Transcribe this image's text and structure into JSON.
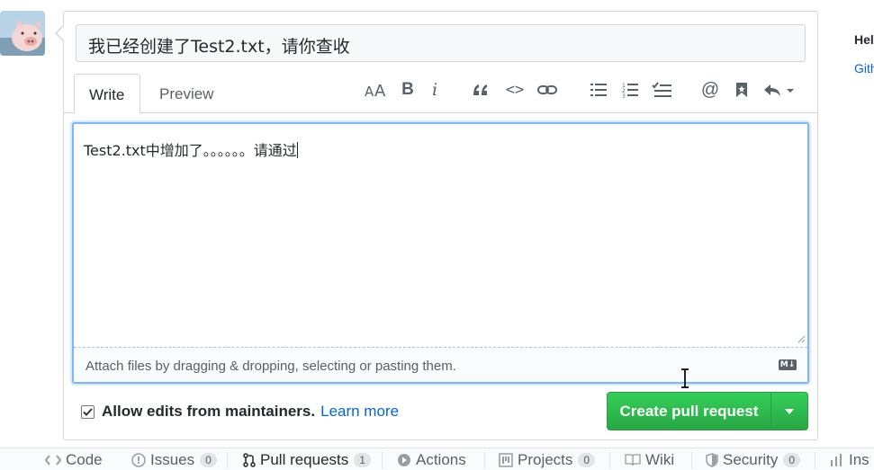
{
  "pr": {
    "title_value": "我已经创建了Test2.txt，请你查收",
    "tabs": [
      {
        "label": "Write"
      },
      {
        "label": "Preview"
      }
    ],
    "toolbar": {
      "header_icon": "text-size-icon",
      "bold_label": "B",
      "italic_label": "i",
      "quote_icon": "quote-icon",
      "code_label": "<>",
      "link_icon": "link-icon",
      "ul_icon": "unordered-list-icon",
      "ol_icon": "ordered-list-icon",
      "tasklist_icon": "task-list-icon",
      "mention_label": "@",
      "reference_icon": "bookmark-icon",
      "reply_icon": "reply-icon"
    },
    "body_value": "Test2.txt中增加了。。。。。。请通过",
    "attach_text": "Attach files by dragging & dropping, selecting or pasting them.",
    "markdown_badge": "M↓",
    "allow_edits_label": "Allow edits from maintainers.",
    "allow_edits_checked": true,
    "learn_more_label": "Learn more",
    "create_button_label": "Create pull request"
  },
  "sidebar": {
    "help_text": "Hel",
    "link_text": "Gith"
  },
  "repo_nav": {
    "items": [
      {
        "label": "Code",
        "icon": "code-icon"
      },
      {
        "label": "Issues",
        "count": "0",
        "icon": "issue-icon"
      },
      {
        "label": "Pull requests",
        "count": "1",
        "icon": "pull-request-icon"
      },
      {
        "label": "Actions",
        "icon": "play-icon"
      },
      {
        "label": "Projects",
        "count": "0",
        "icon": "project-icon"
      },
      {
        "label": "Wiki",
        "icon": "book-icon"
      },
      {
        "label": "Security",
        "count": "0",
        "icon": "shield-icon"
      },
      {
        "label": "Ins",
        "icon": "graph-icon"
      }
    ]
  },
  "colors": {
    "accent_blue": "#0366d6",
    "green_button": "#28a745",
    "focus_border": "#79b8ff"
  }
}
